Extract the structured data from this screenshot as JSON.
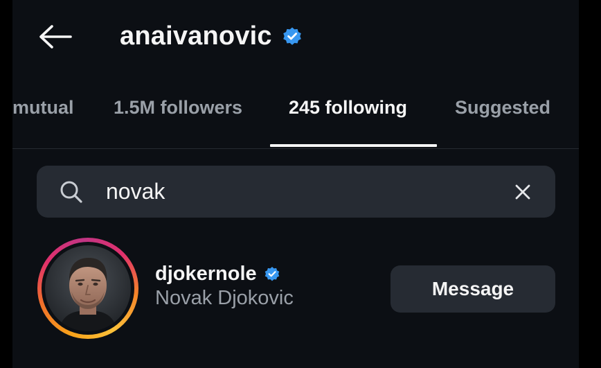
{
  "header": {
    "title": "anaivanovic",
    "back_icon": "arrow-left-icon",
    "verified_icon": "verified-badge-icon"
  },
  "tabs": [
    {
      "label": "mutual",
      "active": false
    },
    {
      "label": "1.5M followers",
      "active": false
    },
    {
      "label": "245 following",
      "active": true
    },
    {
      "label": "Suggested",
      "active": false
    }
  ],
  "search": {
    "value": "novak",
    "icon": "search-icon",
    "clear_icon": "close-icon"
  },
  "results": [
    {
      "username": "djokernole",
      "full_name": "Novak Djokovic",
      "verified": true,
      "has_story_ring": true,
      "action_label": "Message"
    }
  ],
  "colors": {
    "background": "#0c0f14",
    "surface": "#262b33",
    "text_primary": "#f5f5f5",
    "text_secondary": "#9aa0a8",
    "verified_blue": "#3897f0"
  }
}
